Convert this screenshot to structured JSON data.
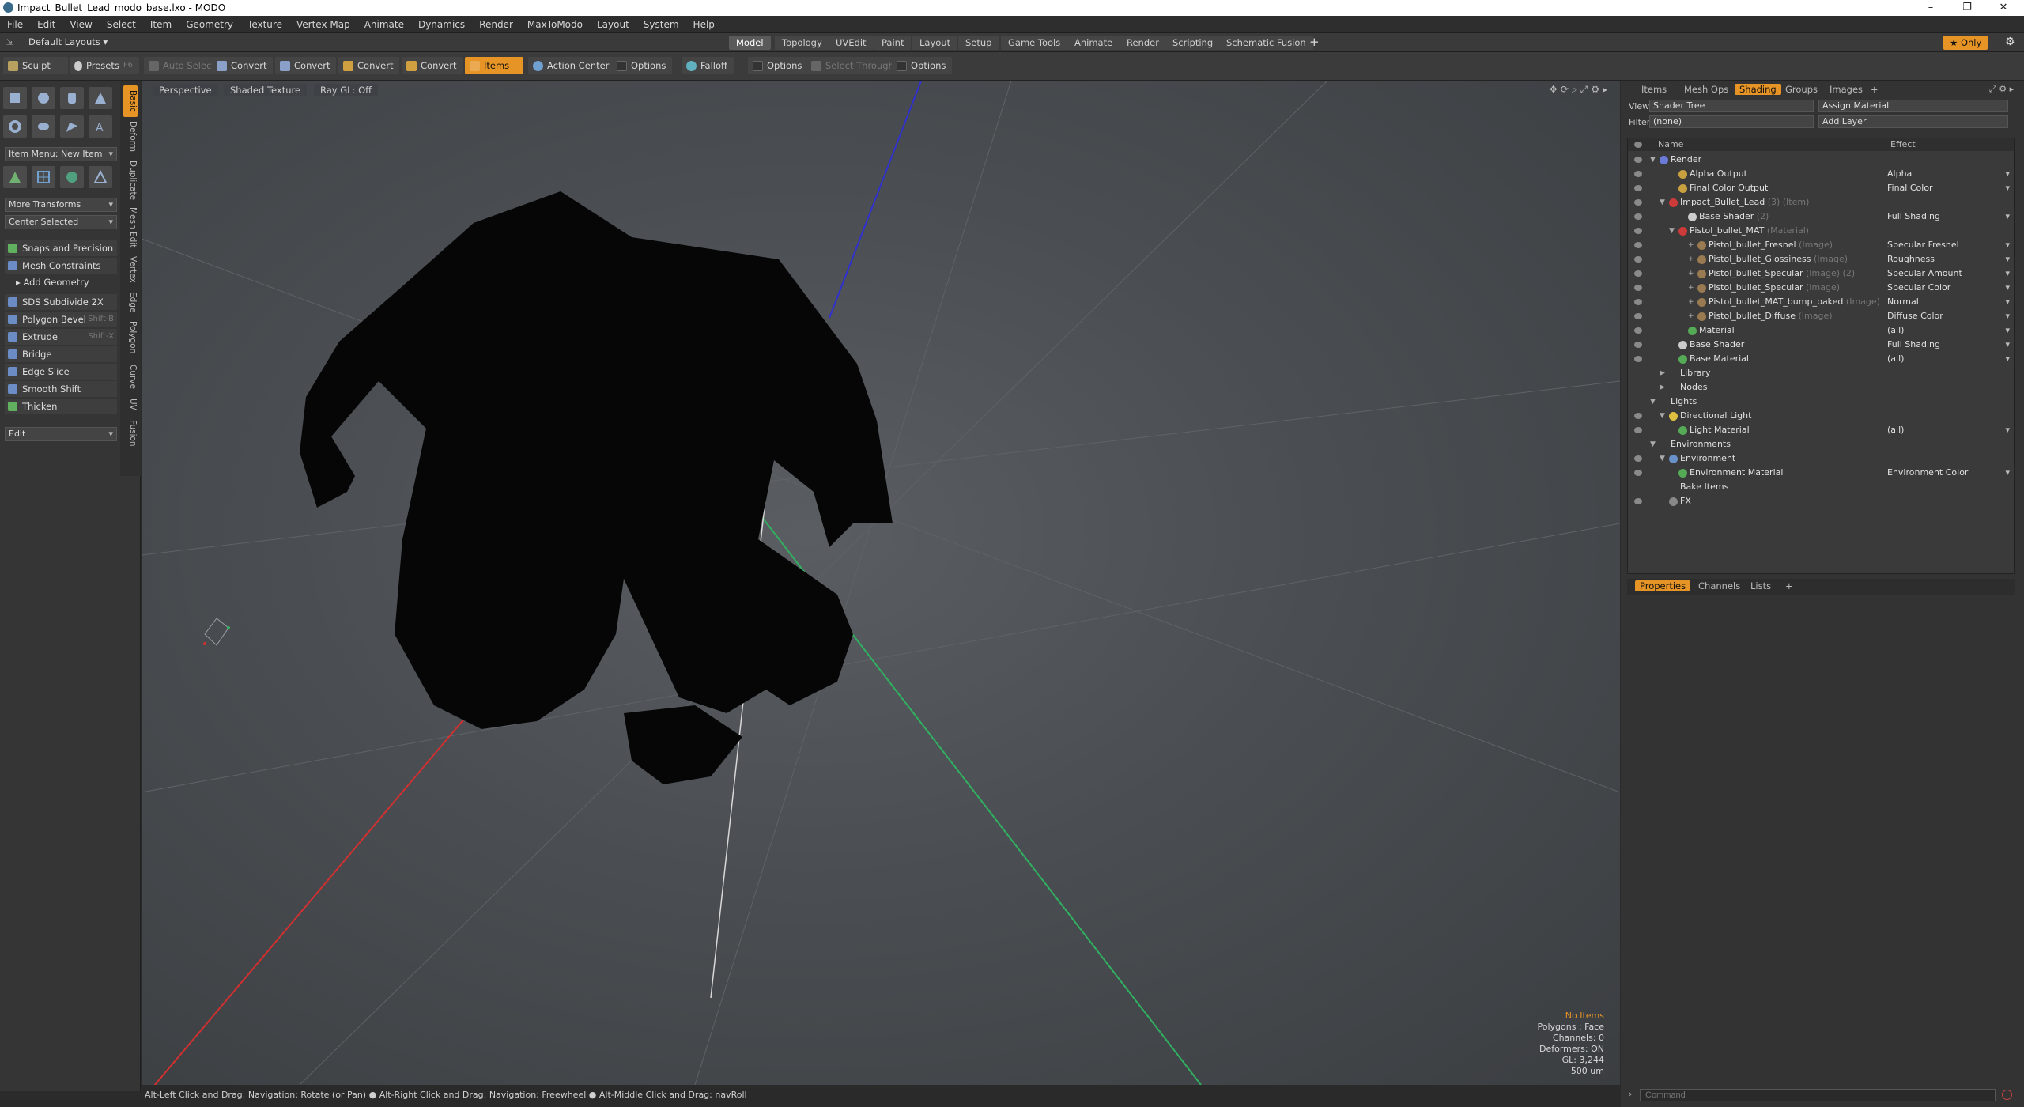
{
  "window": {
    "title": "Impact_Bullet_Lead_modo_base.lxo - MODO"
  },
  "menu": [
    "File",
    "Edit",
    "View",
    "Select",
    "Item",
    "Geometry",
    "Texture",
    "Vertex Map",
    "Animate",
    "Dynamics",
    "Render",
    "MaxToModo",
    "Layout",
    "System",
    "Help"
  ],
  "layouts": {
    "current": "Default Layouts",
    "tabs": [
      "Model",
      "Topology",
      "UVEdit",
      "Paint",
      "Layout",
      "Setup",
      "Game Tools",
      "Animate",
      "Render",
      "Scripting",
      "Schematic Fusion"
    ],
    "active": "Model",
    "add": "+",
    "only": "Only"
  },
  "toolbar": {
    "sculpt": "Sculpt",
    "presets": "Presets",
    "presets_key": "F6",
    "auto_select": "Auto Select",
    "convert": "Convert",
    "items": "Items",
    "action_center": "Action Center",
    "options": "Options",
    "falloff": "Falloff",
    "select_through": "Select Through"
  },
  "left": {
    "vtabs": [
      "Basic",
      "Deform",
      "Duplicate",
      "Mesh Edit",
      "Vertex",
      "Edge",
      "Polygon",
      "Curve",
      "UV",
      "Fusion"
    ],
    "item_menu": "Item Menu: New Item",
    "more_transforms": "More Transforms",
    "center_selected": "Center Selected",
    "snaps": "Snaps and Precision",
    "mesh_constraints": "Mesh Constraints",
    "add_geometry": "Add Geometry",
    "tools": [
      {
        "label": "SDS Subdivide 2X",
        "key": ""
      },
      {
        "label": "Polygon Bevel",
        "key": "Shift-B"
      },
      {
        "label": "Extrude",
        "key": "Shift-X"
      },
      {
        "label": "Bridge",
        "key": ""
      },
      {
        "label": "Edge Slice",
        "key": ""
      },
      {
        "label": "Smooth Shift",
        "key": ""
      },
      {
        "label": "Thicken",
        "key": ""
      }
    ],
    "edit": "Edit"
  },
  "viewport": {
    "view": "Perspective",
    "shading": "Shaded Texture",
    "raygl": "Ray GL: Off",
    "stats": {
      "items": "No Items",
      "polygons": "Polygons : Face",
      "channels": "Channels: 0",
      "deformers": "Deformers: ON",
      "gl": "GL: 3,244",
      "scale": "500 um"
    }
  },
  "status": "Alt-Left Click and Drag: Navigation: Rotate (or Pan) ● Alt-Right Click and Drag: Navigation: Freewheel ● Alt-Middle Click and Drag: navRoll",
  "right": {
    "tabs": [
      "Items",
      "Mesh Ops",
      "Shading",
      "Groups",
      "Images"
    ],
    "active": "Shading",
    "view_label": "View",
    "view_value": "Shader Tree",
    "assign_material": "Assign Material",
    "filter_label": "Filter",
    "filter_value": "(none)",
    "add_layer": "Add Layer",
    "col_name": "Name",
    "col_effect": "Effect",
    "rows": [
      {
        "name": "Render",
        "tag": "",
        "effect": "",
        "indent": 0,
        "toggle": "▼",
        "icon": "#6a7ad8"
      },
      {
        "name": "Alpha Output",
        "tag": "",
        "effect": "Alpha",
        "indent": 2,
        "toggle": "",
        "icon": "#c8a040"
      },
      {
        "name": "Final Color Output",
        "tag": "",
        "effect": "Final Color",
        "indent": 2,
        "toggle": "",
        "icon": "#c8a040"
      },
      {
        "name": "Impact_Bullet_Lead",
        "tag": "(3) (Item)",
        "effect": "",
        "indent": 1,
        "toggle": "▼",
        "icon": "#cc3a3a"
      },
      {
        "name": "Base Shader",
        "tag": "(2)",
        "effect": "Full Shading",
        "indent": 3,
        "toggle": "",
        "icon": "#cccccc"
      },
      {
        "name": "Pistol_bullet_MAT",
        "tag": "(Material)",
        "effect": "",
        "indent": 2,
        "toggle": "▼",
        "icon": "#cc3a3a"
      },
      {
        "name": "Pistol_bullet_Fresnel",
        "tag": "(Image)",
        "effect": "Specular Fresnel",
        "indent": 4,
        "toggle": "+",
        "icon": "#9a7a50"
      },
      {
        "name": "Pistol_bullet_Glossiness",
        "tag": "(Image)",
        "effect": "Roughness",
        "indent": 4,
        "toggle": "+",
        "icon": "#9a7a50"
      },
      {
        "name": "Pistol_bullet_Specular",
        "tag": "(Image) (2)",
        "effect": "Specular Amount",
        "indent": 4,
        "toggle": "+",
        "icon": "#9a7a50"
      },
      {
        "name": "Pistol_bullet_Specular",
        "tag": "(Image)",
        "effect": "Specular Color",
        "indent": 4,
        "toggle": "+",
        "icon": "#9a7a50"
      },
      {
        "name": "Pistol_bullet_MAT_bump_baked",
        "tag": "(Image)",
        "effect": "Normal",
        "indent": 4,
        "toggle": "+",
        "icon": "#9a7a50"
      },
      {
        "name": "Pistol_bullet_Diffuse",
        "tag": "(Image)",
        "effect": "Diffuse Color",
        "indent": 4,
        "toggle": "+",
        "icon": "#9a7a50"
      },
      {
        "name": "Material",
        "tag": "",
        "effect": "(all)",
        "indent": 3,
        "toggle": "",
        "icon": "#55aa55"
      },
      {
        "name": "Base Shader",
        "tag": "",
        "effect": "Full Shading",
        "indent": 2,
        "toggle": "",
        "icon": "#cccccc"
      },
      {
        "name": "Base Material",
        "tag": "",
        "effect": "(all)",
        "indent": 2,
        "toggle": "",
        "icon": "#55aa55"
      },
      {
        "name": "Library",
        "tag": "",
        "effect": "",
        "indent": 1,
        "toggle": "▶",
        "icon": ""
      },
      {
        "name": "Nodes",
        "tag": "",
        "effect": "",
        "indent": 1,
        "toggle": "▶",
        "icon": ""
      },
      {
        "name": "Lights",
        "tag": "",
        "effect": "",
        "indent": 0,
        "toggle": "▼",
        "icon": ""
      },
      {
        "name": "Directional Light",
        "tag": "",
        "effect": "",
        "indent": 1,
        "toggle": "▼",
        "icon": "#e0c040"
      },
      {
        "name": "Light Material",
        "tag": "",
        "effect": "(all)",
        "indent": 2,
        "toggle": "",
        "icon": "#55aa55"
      },
      {
        "name": "Environments",
        "tag": "",
        "effect": "",
        "indent": 0,
        "toggle": "▼",
        "icon": ""
      },
      {
        "name": "Environment",
        "tag": "",
        "effect": "",
        "indent": 1,
        "toggle": "▼",
        "icon": "#6a90c8"
      },
      {
        "name": "Environment Material",
        "tag": "",
        "effect": "Environment Color",
        "indent": 2,
        "toggle": "",
        "icon": "#55aa55"
      },
      {
        "name": "Bake Items",
        "tag": "",
        "effect": "",
        "indent": 1,
        "toggle": "",
        "icon": ""
      },
      {
        "name": "FX",
        "tag": "",
        "effect": "",
        "indent": 1,
        "toggle": "",
        "icon": "#888888"
      }
    ],
    "prop_tabs": [
      "Properties",
      "Channels",
      "Lists"
    ],
    "prop_active": "Properties",
    "command_placeholder": "Command"
  },
  "colors": {
    "accent": "#e69426",
    "x_axis": "#d23030",
    "y_axis": "#3030d0",
    "z_axis": "#30b060"
  }
}
